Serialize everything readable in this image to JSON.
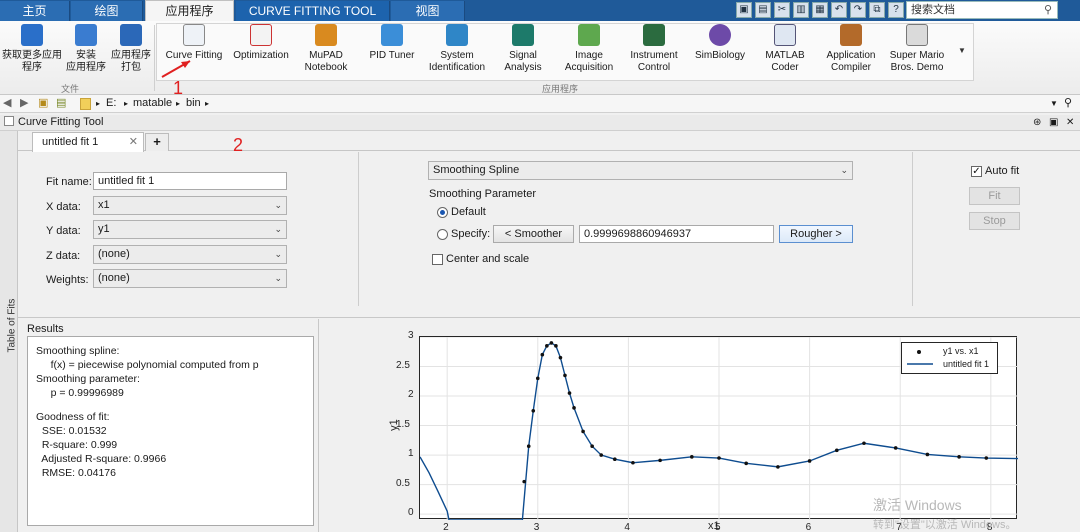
{
  "tabs": {
    "home": "主页",
    "plots": "绘图",
    "apps": "应用程序",
    "curve_fitting_tool": "CURVE FITTING TOOL",
    "view": "视图"
  },
  "search_placeholder": "搜索文档",
  "ribbon": {
    "file_items": [
      {
        "label": "获取更多应用\n程序",
        "icon": "download-icon"
      },
      {
        "label": "安装\n应用程序",
        "icon": "install-icon"
      },
      {
        "label": "应用程序\n打包",
        "icon": "package-icon"
      }
    ],
    "file_group_label": "文件",
    "app_group_label": "应用程序",
    "apps": [
      {
        "label": "Curve Fitting",
        "icon": "curve-fitting-icon"
      },
      {
        "label": "Optimization",
        "icon": "optimization-icon"
      },
      {
        "label": "MuPAD\nNotebook",
        "icon": "mupad-icon"
      },
      {
        "label": "PID Tuner",
        "icon": "pid-tuner-icon"
      },
      {
        "label": "System\nIdentification",
        "icon": "system-identification-icon"
      },
      {
        "label": "Signal\nAnalysis",
        "icon": "signal-analysis-icon"
      },
      {
        "label": "Image\nAcquisition",
        "icon": "image-acquisition-icon"
      },
      {
        "label": "Instrument\nControl",
        "icon": "instrument-control-icon"
      },
      {
        "label": "SimBiology",
        "icon": "simbiology-icon"
      },
      {
        "label": "MATLAB\nCoder",
        "icon": "matlab-coder-icon"
      },
      {
        "label": "Application\nCompiler",
        "icon": "application-compiler-icon"
      },
      {
        "label": "Super Mario\nBros. Demo",
        "icon": "super-mario-icon"
      }
    ]
  },
  "address": {
    "drive": "E:",
    "folder1": "matable",
    "folder2": "bin"
  },
  "tool_title": "Curve Fitting Tool",
  "side_tab": "Table of Fits",
  "doc_tab": "untitled fit 1",
  "annotations": {
    "one": "1",
    "two": "2"
  },
  "fit": {
    "fit_name_label": "Fit name:",
    "fit_name_value": "untitled fit 1",
    "x_data_label": "X data:",
    "x_data_value": "x1",
    "y_data_label": "Y data:",
    "y_data_value": "y1",
    "z_data_label": "Z data:",
    "z_data_value": "(none)",
    "weights_label": "Weights:",
    "weights_value": "(none)",
    "fit_type": "Smoothing Spline",
    "smoothing_parameter_label": "Smoothing Parameter",
    "default_label": "Default",
    "specify_label": "Specify:",
    "smoother_btn": "< Smoother",
    "specify_value": "0.9999698860946937",
    "rougher_btn": "Rougher >",
    "center_scale_label": "Center and scale",
    "auto_fit_label": "Auto fit",
    "fit_btn": "Fit",
    "stop_btn": "Stop"
  },
  "results": {
    "title": "Results",
    "lines": [
      "Smoothing spline:",
      "     f(x) = piecewise polynomial computed from p",
      "Smoothing parameter:",
      "     p = 0.99996989",
      "",
      "Goodness of fit:",
      "  SSE: 0.01532",
      "  R-square: 0.999",
      "  Adjusted R-square: 0.9966",
      "  RMSE: 0.04176"
    ]
  },
  "watermark": {
    "line1": "激活 Windows",
    "line2": "转到\"设置\"以激活 Windows。"
  },
  "chart_data": {
    "type": "scatter",
    "xlabel": "x1",
    "ylabel": "y1",
    "xlim": [
      1.7,
      8.3
    ],
    "ylim": [
      -0.1,
      3.0
    ],
    "x_ticks": [
      2,
      3,
      4,
      5,
      6,
      7,
      8
    ],
    "y_ticks": [
      0,
      0.5,
      1,
      1.5,
      2,
      2.5,
      3
    ],
    "grid": true,
    "legend_position": "top-right",
    "series": [
      {
        "name": "y1 vs. x1",
        "kind": "points",
        "x": [
          2.85,
          2.9,
          2.95,
          3.0,
          3.05,
          3.1,
          3.15,
          3.2,
          3.25,
          3.3,
          3.35,
          3.4,
          3.5,
          3.6,
          3.7,
          3.85,
          4.05,
          4.35,
          4.7,
          5.0,
          5.3,
          5.65,
          6.0,
          6.3,
          6.6,
          6.95,
          7.3,
          7.65,
          7.95
        ],
        "y": [
          0.55,
          1.15,
          1.75,
          2.3,
          2.7,
          2.85,
          2.9,
          2.85,
          2.65,
          2.35,
          2.05,
          1.8,
          1.4,
          1.15,
          1.0,
          0.93,
          0.87,
          0.91,
          0.97,
          0.95,
          0.86,
          0.8,
          0.9,
          1.08,
          1.2,
          1.12,
          1.01,
          0.97,
          0.95
        ]
      },
      {
        "name": "untitled fit 1",
        "kind": "line",
        "x": [
          1.7,
          1.8,
          1.9,
          2.0,
          2.02,
          2.83,
          2.9,
          2.95,
          3.0,
          3.05,
          3.1,
          3.15,
          3.2,
          3.25,
          3.3,
          3.35,
          3.4,
          3.5,
          3.6,
          3.7,
          3.85,
          4.05,
          4.35,
          4.7,
          5.0,
          5.3,
          5.65,
          6.0,
          6.3,
          6.6,
          6.95,
          7.3,
          7.65,
          7.95,
          8.3
        ],
        "y": [
          0.97,
          0.7,
          0.38,
          0.05,
          -0.1,
          -0.1,
          1.15,
          1.75,
          2.3,
          2.7,
          2.85,
          2.9,
          2.85,
          2.65,
          2.35,
          2.05,
          1.8,
          1.4,
          1.15,
          1.0,
          0.93,
          0.87,
          0.91,
          0.97,
          0.95,
          0.86,
          0.8,
          0.9,
          1.08,
          1.2,
          1.12,
          1.01,
          0.97,
          0.95,
          0.94
        ]
      }
    ]
  },
  "colors": {
    "tab_bar": "#1f5a99",
    "fit_line": "#0e4c8f",
    "annotation": "#e02020"
  }
}
